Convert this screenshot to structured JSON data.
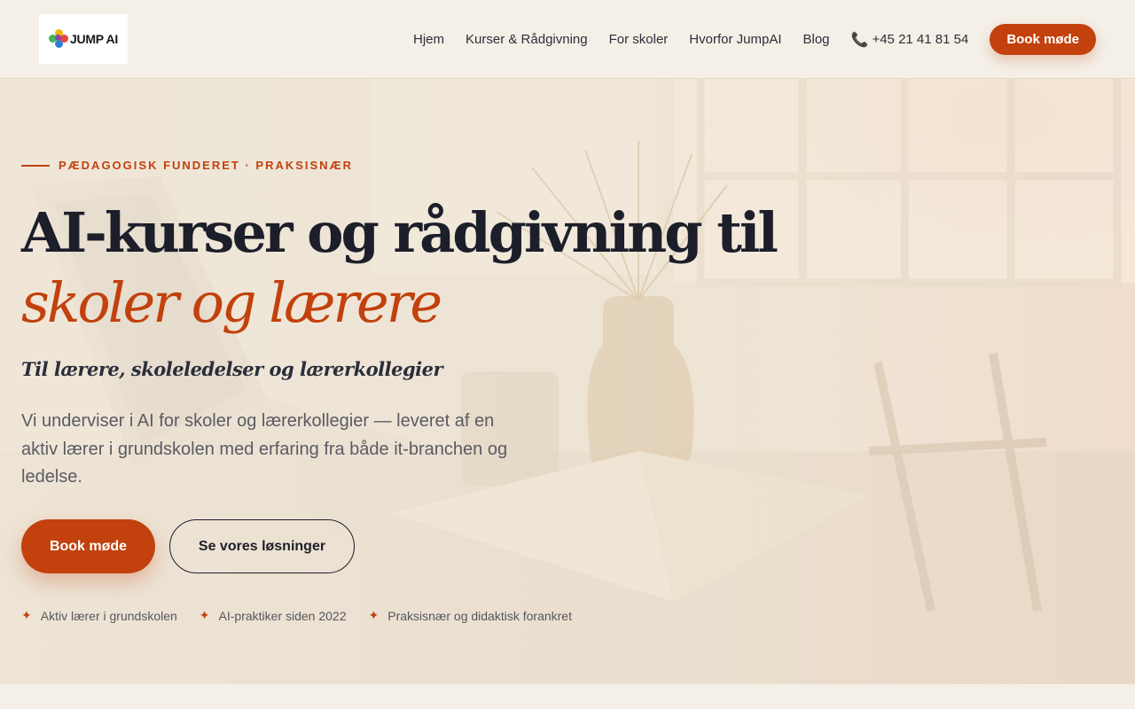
{
  "header": {
    "logo_text": "JUMP AI",
    "nav": [
      "Hjem",
      "Kurser & Rådgivning",
      "For skoler",
      "Hvorfor JumpAI",
      "Blog"
    ],
    "phone": "+45 21 41 81 54",
    "cta": "Book møde"
  },
  "hero": {
    "eyebrow": "PÆDAGOGISK FUNDERET · PRAKSISNÆR",
    "title": "AI-kurser og rådgivning til",
    "title_accent": "skoler og lærere",
    "subtitle": "Til lærere, skoleledelser og lærerkollegier",
    "lead": "Vi underviser i AI for skoler og lærerkollegier — leveret af en aktiv lærer i grundskolen med erfaring fra både it-branchen og ledelse.",
    "primary_button": "Book møde",
    "secondary_button": "Se vores løsninger",
    "features": [
      "Aktiv lærer i grundskolen",
      "AI-praktiker siden 2022",
      "Praksisnær og didaktisk forankret"
    ]
  },
  "colors": {
    "accent": "#c2410c",
    "background": "#f4efe7",
    "text": "#1c1f2a"
  },
  "icons": {
    "phone": "phone-icon",
    "feature": "sparkle-icon"
  }
}
